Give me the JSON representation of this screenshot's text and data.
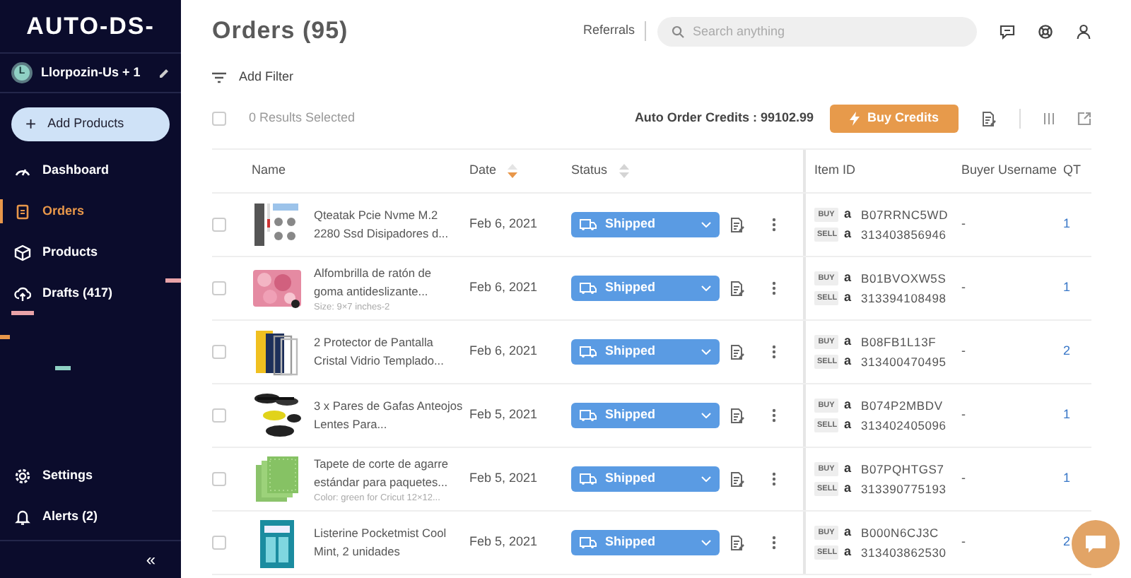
{
  "sidebar": {
    "logo": "AUTO-DS-",
    "account": {
      "avatar": "L",
      "name": "Llorpozin-Us + 1"
    },
    "add_button": {
      "icon": "+",
      "label": "Add Products"
    },
    "nav": [
      {
        "label": "Dashboard",
        "selected": false
      },
      {
        "label": "Orders",
        "selected": true
      },
      {
        "label": "Products",
        "selected": false
      },
      {
        "label": "Drafts (417)",
        "selected": false
      }
    ],
    "bottom_nav": [
      {
        "label": "Settings"
      },
      {
        "label": "Alerts (2)"
      }
    ],
    "collapse": "«"
  },
  "header": {
    "title": "Orders (95)",
    "referrals": "Referrals",
    "search": {
      "placeholder": "Search anything"
    }
  },
  "filter": {
    "label": "Add Filter"
  },
  "toolbar": {
    "selection": "0 Results Selected",
    "checked": false,
    "credits": "Auto Order Credits : 99102.99",
    "buy_button": "Buy Credits"
  },
  "table": {
    "columns": [
      {
        "label": "Name",
        "sortable": false
      },
      {
        "label": "Date",
        "sortable": true,
        "sorted": true
      },
      {
        "label": "Status",
        "sortable": true,
        "sorted": false
      },
      {
        "label": "Item ID",
        "sortable": false
      },
      {
        "label": "Buyer Username",
        "sortable": false
      },
      {
        "label": "QT",
        "sortable": false
      }
    ],
    "rows": [
      {
        "checked": false,
        "name": "Qteatak Pcie Nvme M.2 2280 Ssd Disipadores d...",
        "date": "Feb 6, 2021",
        "status": "Shipped",
        "buy_tag": "BUY",
        "buy_mark": "a",
        "buy_id": "B07RRNC5WD",
        "sell_tag": "SELL",
        "sell_mark": "a",
        "sell_id": "313403856946",
        "buyer": "-",
        "qty": "1"
      },
      {
        "checked": false,
        "name": "Alfombrilla de ratón de goma antideslizante...",
        "variant": "Size: 9×7 inches-2",
        "date": "Feb 6, 2021",
        "status": "Shipped",
        "buy_tag": "BUY",
        "buy_mark": "a",
        "buy_id": "B01BVOXW5S",
        "sell_tag": "SELL",
        "sell_mark": "a",
        "sell_id": "313394108498",
        "buyer": "-",
        "qty": "1"
      },
      {
        "checked": false,
        "name": "2 Protector de Pantalla Cristal Vidrio Templado...",
        "date": "Feb 6, 2021",
        "status": "Shipped",
        "buy_tag": "BUY",
        "buy_mark": "a",
        "buy_id": "B08FB1L13F",
        "sell_tag": "SELL",
        "sell_mark": "a",
        "sell_id": "313400470495",
        "buyer": "-",
        "qty": "2"
      },
      {
        "checked": false,
        "name": "3 x Pares de Gafas Anteojos Lentes Para...",
        "date": "Feb 5, 2021",
        "status": "Shipped",
        "buy_tag": "BUY",
        "buy_mark": "a",
        "buy_id": "B074P2MBDV",
        "sell_tag": "SELL",
        "sell_mark": "a",
        "sell_id": "313402405096",
        "buyer": "-",
        "qty": "1"
      },
      {
        "checked": false,
        "name": "Tapete de corte de agarre estándar para paquetes...",
        "variant": "Color: green for Cricut 12×12...",
        "date": "Feb 5, 2021",
        "status": "Shipped",
        "buy_tag": "BUY",
        "buy_mark": "a",
        "buy_id": "B07PQHTGS7",
        "sell_tag": "SELL",
        "sell_mark": "a",
        "sell_id": "313390775193",
        "buyer": "-",
        "qty": "1"
      },
      {
        "checked": false,
        "name": "Listerine Pocketmist Cool Mint, 2 unidades",
        "date": "Feb 5, 2021",
        "status": "Shipped",
        "buy_tag": "BUY",
        "buy_mark": "a",
        "buy_id": "B000N6CJ3C",
        "sell_tag": "SELL",
        "sell_mark": "a",
        "sell_id": "313403862530",
        "buyer": "-",
        "qty": "2"
      }
    ]
  }
}
